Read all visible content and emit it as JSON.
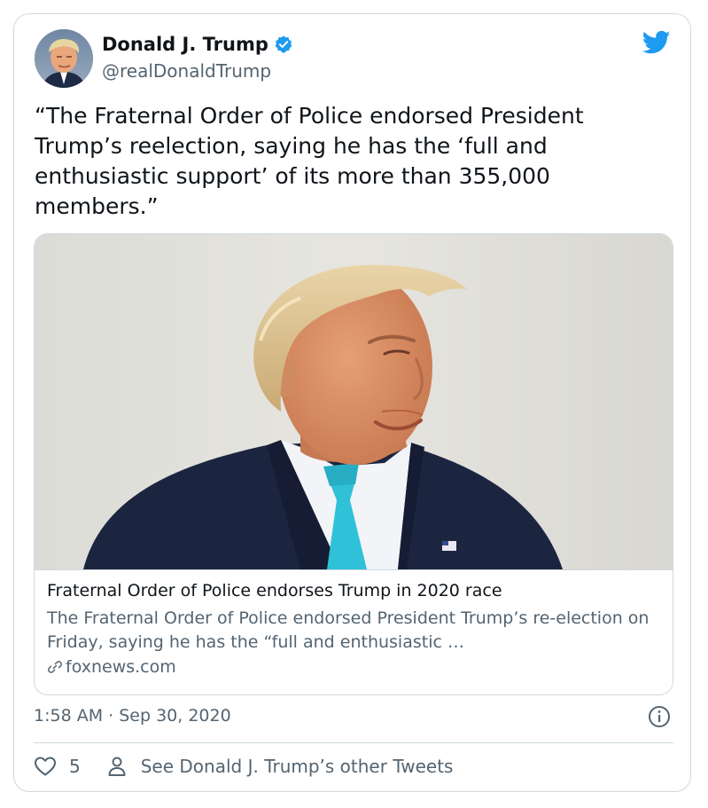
{
  "colors": {
    "accent": "#1d9bf0",
    "text": "#0f1419",
    "secondary": "#536471",
    "border": "#cfd9de"
  },
  "author": {
    "name": "Donald J. Trump",
    "handle": "@realDonaldTrump",
    "avatar_icon": "avatar-photo",
    "verified_icon": "verified-badge-icon"
  },
  "brand_icon": "twitter-bird-icon",
  "tweet": {
    "text": "“The Fraternal Order of Police endorsed President Trump’s reelection, saying he has the ‘full and enthusiastic support’ of its more than 355,000 members.”"
  },
  "link_card": {
    "title": "Fraternal Order of Police endorses Trump in 2020 race",
    "description": "The Fraternal Order of Police endorsed President Trump’s re-election on Friday, saying he has the “full and enthusiastic …",
    "domain": "foxnews.com",
    "domain_icon": "link-icon"
  },
  "meta": {
    "timestamp": "1:58 AM · Sep 30, 2020",
    "info_icon": "info-icon"
  },
  "actions": {
    "likes": "5",
    "other_tweets_label": "See Donald J. Trump’s other Tweets"
  }
}
